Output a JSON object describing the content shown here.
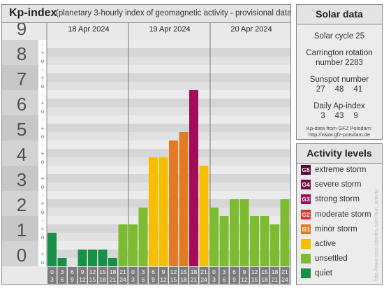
{
  "kp_panel": {
    "title": "Kp-index",
    "subtitle": "(planetary 3-hourly index of geomagnetic activity - provisional data)"
  },
  "chart_data": {
    "type": "bar",
    "ylim": [
      0,
      9
    ],
    "yticks": [
      "0",
      "1",
      "2",
      "3",
      "4",
      "5",
      "6",
      "7",
      "8",
      "9"
    ],
    "minor_ticks": [
      "o",
      "+",
      "-"
    ],
    "days": [
      "18 Apr 2024",
      "19 Apr 2024",
      "20 Apr 2024"
    ],
    "hour_bins": [
      [
        "0",
        "3"
      ],
      [
        "3",
        "6"
      ],
      [
        "6",
        "9"
      ],
      [
        "9",
        "12"
      ],
      [
        "12",
        "15"
      ],
      [
        "15",
        "18"
      ],
      [
        "18",
        "21"
      ],
      [
        "21",
        "24"
      ]
    ],
    "values": [
      1.333,
      0.333,
      0.0,
      0.667,
      0.667,
      0.667,
      0.333,
      1.667,
      1.667,
      2.333,
      4.333,
      4.333,
      5.0,
      5.333,
      7.0,
      4.0,
      2.333,
      2.0,
      2.667,
      2.667,
      2.0,
      2.0,
      1.667,
      2.667
    ],
    "colors": [
      "#179148",
      "#179148",
      "#179148",
      "#179148",
      "#179148",
      "#179148",
      "#179148",
      "#7dbc30",
      "#7dbc30",
      "#7dbc30",
      "#f6be00",
      "#f6be00",
      "#e27a24",
      "#e27a24",
      "#a40c59",
      "#f6be00",
      "#7dbc30",
      "#7dbc30",
      "#7dbc30",
      "#7dbc30",
      "#7dbc30",
      "#7dbc30",
      "#7dbc30",
      "#7dbc30"
    ]
  },
  "solar": {
    "title": "Solar data",
    "cycle": "Solar cycle 25",
    "carrington_line1": "Carrington rotation",
    "carrington_line2": "number 2283",
    "sunspot_label": "Sunspot number",
    "sunspot_values": [
      "27",
      "48",
      "41"
    ],
    "ap_label": "Daily Ap-index",
    "ap_values": [
      "3",
      "43",
      "9"
    ],
    "credit_line1": "Kp-data from GFZ Potsdam:",
    "credit_line2": "http://www.gfz-potsdam.de"
  },
  "activity": {
    "title": "Activity levels",
    "levels": [
      {
        "code": "G5",
        "label": "extreme storm",
        "color": "#5a0535"
      },
      {
        "code": "G4",
        "label": "severe storm",
        "color": "#7a0a45"
      },
      {
        "code": "G3",
        "label": "strong storm",
        "color": "#a40c59"
      },
      {
        "code": "G2",
        "label": "moderate storm",
        "color": "#d9362b"
      },
      {
        "code": "G1",
        "label": "minor storm",
        "color": "#e27a24"
      },
      {
        "code": "",
        "label": "active",
        "color": "#f6be00"
      },
      {
        "code": "",
        "label": "unsettled",
        "color": "#7dbc30"
      },
      {
        "code": "",
        "label": "quiet",
        "color": "#179148"
      }
    ]
  },
  "watermark": "http://www.tesis.lebedev.ru/en/sun_activity"
}
